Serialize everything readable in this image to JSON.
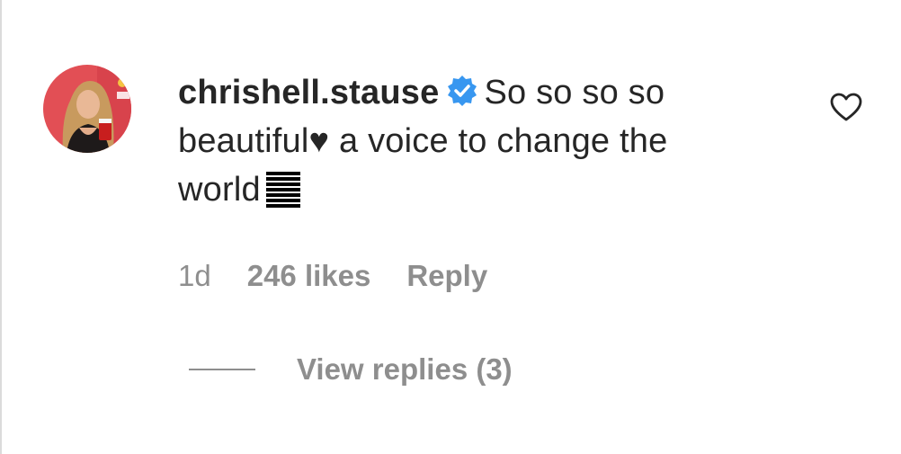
{
  "comment": {
    "username": "chrishell.stause",
    "verified_icon": "verified-badge-icon",
    "text_line_1": "So so so so",
    "text_line_2": "beautiful♥ a voice to change the",
    "text_line_3": "world",
    "like_icon": "heart-outline-icon",
    "avatar_icon": "profile-photo"
  },
  "meta": {
    "age": "1d",
    "likes": "246 likes",
    "reply_label": "Reply"
  },
  "replies": {
    "view_label": "View replies (3)"
  },
  "colors": {
    "text": "#262626",
    "secondary": "#8e8e8e",
    "verified_blue": "#3897f0",
    "avatar_bg": "#e8505b"
  }
}
